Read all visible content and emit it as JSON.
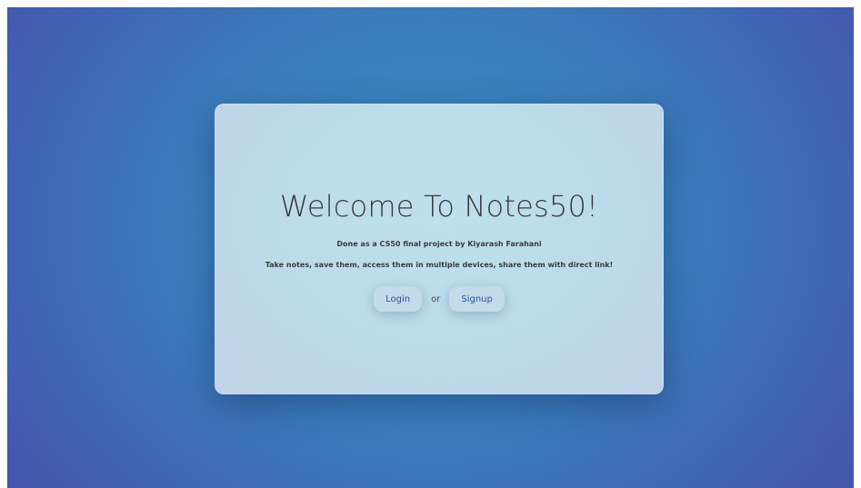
{
  "welcome": {
    "title": "Welcome To Notes50!",
    "subtitle": "Done as a CS50 final project by Kiyarash Farahani",
    "tagline": "Take notes, save them, access them in multiple devices, share them with direct link!"
  },
  "actions": {
    "login_label": "Login",
    "separator": "or",
    "signup_label": "Signup"
  },
  "colors": {
    "background_center": "#3a8ec0",
    "background_edge": "#4457ad",
    "card": "#bde0ec",
    "button_text": "#2f4f93",
    "heading_text": "#3a3a3c"
  }
}
